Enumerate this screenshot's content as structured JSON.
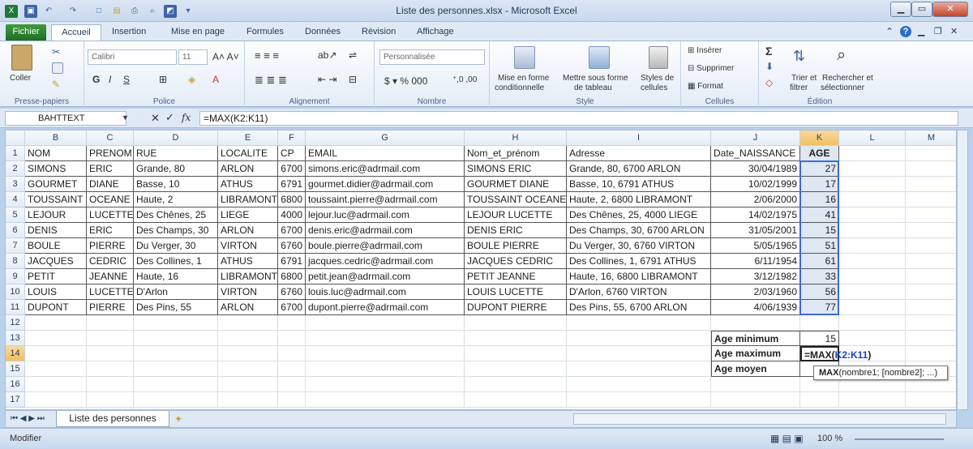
{
  "window": {
    "title": "Liste des personnes.xlsx - Microsoft Excel"
  },
  "ribbon_tabs": [
    "Fichier",
    "Accueil",
    "Insertion",
    "Mise en page",
    "Formules",
    "Données",
    "Révision",
    "Affichage"
  ],
  "ribbon": {
    "coller": "Coller",
    "font_name": "Calibri",
    "font_size": "11",
    "number_format": "Personnalisée",
    "groups": [
      "Presse-papiers",
      "Police",
      "Alignement",
      "Nombre",
      "Style",
      "Cellules",
      "Édition"
    ],
    "mise_en_forme": "Mise en forme",
    "conditionnelle": "conditionnelle",
    "mettre_sous_forme": "Mettre sous forme",
    "de_tableau": "de tableau",
    "styles_de": "Styles de",
    "cellules": "cellules",
    "inserer": "Insérer",
    "supprimer": "Supprimer",
    "format": "Format",
    "trier_et": "Trier et",
    "filtrer": "filtrer",
    "rechercher_et": "Rechercher et",
    "selectionner": "sélectionner"
  },
  "formula_bar": {
    "name_box": "BAHTTEXT",
    "formula": "=MAX(K2:K11)"
  },
  "columns": [
    "B",
    "C",
    "D",
    "E",
    "F",
    "G",
    "H",
    "I",
    "J",
    "K",
    "L",
    "M"
  ],
  "headers": [
    "NOM",
    "PRENOM",
    "RUE",
    "LOCALITE",
    "CP",
    "EMAIL",
    "Nom_et_prénom",
    "Adresse",
    "Date_NAISSANCE",
    "AGE"
  ],
  "rows": [
    [
      "SIMONS",
      "ERIC",
      "Grande, 80",
      "ARLON",
      "6700",
      "simons.eric@adrmail.com",
      "SIMONS ERIC",
      "Grande, 80, 6700 ARLON",
      "30/04/1989",
      "27"
    ],
    [
      "GOURMET",
      "DIANE",
      "Basse, 10",
      "ATHUS",
      "6791",
      "gourmet.didier@adrmail.com",
      "GOURMET DIANE",
      "Basse, 10, 6791 ATHUS",
      "10/02/1999",
      "17"
    ],
    [
      "TOUSSAINT",
      "OCEANE",
      "Haute, 2",
      "LIBRAMONT",
      "6800",
      "toussaint.pierre@adrmail.com",
      "TOUSSAINT OCEANE",
      "Haute, 2, 6800 LIBRAMONT",
      "2/06/2000",
      "16"
    ],
    [
      "LEJOUR",
      "LUCETTE",
      "Des Chênes, 25",
      "LIEGE",
      "4000",
      "lejour.luc@adrmail.com",
      "LEJOUR LUCETTE",
      "Des Chênes, 25, 4000 LIEGE",
      "14/02/1975",
      "41"
    ],
    [
      "DENIS",
      "ERIC",
      "Des Champs, 30",
      "ARLON",
      "6700",
      "denis.eric@adrmail.com",
      "DENIS ERIC",
      "Des Champs, 30, 6700 ARLON",
      "31/05/2001",
      "15"
    ],
    [
      "BOULE",
      "PIERRE",
      "Du Verger, 30",
      "VIRTON",
      "6760",
      "boule.pierre@adrmail.com",
      "BOULE PIERRE",
      "Du Verger, 30, 6760 VIRTON",
      "5/05/1965",
      "51"
    ],
    [
      "JACQUES",
      "CEDRIC",
      "Des Collines, 1",
      "ATHUS",
      "6791",
      "jacques.cedric@adrmail.com",
      "JACQUES CEDRIC",
      "Des Collines, 1, 6791 ATHUS",
      "6/11/1954",
      "61"
    ],
    [
      "PETIT",
      "JEANNE",
      "Haute, 16",
      "LIBRAMONT",
      "6800",
      "petit.jean@adrmail.com",
      "PETIT JEANNE",
      "Haute, 16, 6800 LIBRAMONT",
      "3/12/1982",
      "33"
    ],
    [
      "LOUIS",
      "LUCETTE",
      "D'Arlon",
      "VIRTON",
      "6760",
      "louis.luc@adrmail.com",
      "LOUIS LUCETTE",
      "D'Arlon, 6760 VIRTON",
      "2/03/1960",
      "56"
    ],
    [
      "DUPONT",
      "PIERRE",
      "Des Pins, 55",
      "ARLON",
      "6700",
      "dupont.pierre@adrmail.com",
      "DUPONT PIERRE",
      "Des Pins, 55, 6700 ARLON",
      "4/06/1939",
      "77"
    ]
  ],
  "row_numbers": [
    "1",
    "2",
    "3",
    "4",
    "5",
    "6",
    "7",
    "8",
    "9",
    "10",
    "11",
    "12",
    "13",
    "14",
    "15",
    "16",
    "17"
  ],
  "summary": {
    "min_label": "Age minimum",
    "min_value": "15",
    "max_label": "Age maximum",
    "max_value": "=MAX(K2:K11)",
    "avg_label": "Age moyen"
  },
  "tooltip": {
    "fn": "MAX",
    "args": "(nombre1; [nombre2]; ...)"
  },
  "sheet_tab": "Liste des personnes",
  "status": {
    "mode": "Modifier",
    "zoom": "100 %"
  },
  "colors": {
    "excel_green": "#1f6f1f",
    "selection": "#dfe7f2",
    "ref_blue": "#1a3fd6"
  }
}
